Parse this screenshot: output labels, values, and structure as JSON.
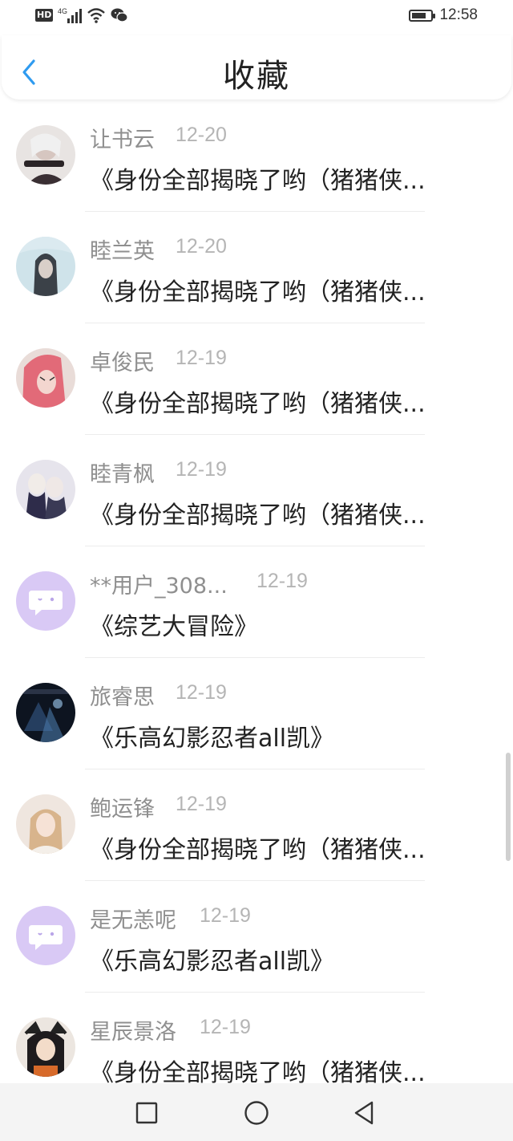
{
  "status_bar": {
    "hd": "HD",
    "network": "4G",
    "time": "12:58",
    "battery_level": 0.75
  },
  "header": {
    "title": "收藏",
    "back_icon": "chevron-left-icon"
  },
  "items": [
    {
      "name": "让书云",
      "date": "12-20",
      "message": "《身份全部揭晓了哟（猪猪侠...",
      "avatar": "anime-photo"
    },
    {
      "name": "睦兰英",
      "date": "12-20",
      "message": "《身份全部揭晓了哟（猪猪侠...",
      "avatar": "anime-photo"
    },
    {
      "name": "卓俊民",
      "date": "12-19",
      "message": "《身份全部揭晓了哟（猪猪侠...",
      "avatar": "anime-photo"
    },
    {
      "name": "睦青枫",
      "date": "12-19",
      "message": "《身份全部揭晓了哟（猪猪侠...",
      "avatar": "anime-photo"
    },
    {
      "name": "**用户_308...",
      "date": "12-19",
      "message": "《综艺大冒险》",
      "avatar": "chat-bubble-icon"
    },
    {
      "name": "旅睿思",
      "date": "12-19",
      "message": "《乐高幻影忍者all凯》",
      "avatar": "anime-photo"
    },
    {
      "name": "鲍运锋",
      "date": "12-19",
      "message": "《身份全部揭晓了哟（猪猪侠...",
      "avatar": "anime-photo"
    },
    {
      "name": "是无恙呢",
      "date": "12-19",
      "message": "《乐高幻影忍者all凯》",
      "avatar": "chat-bubble-icon"
    },
    {
      "name": "星辰景洛",
      "date": "12-19",
      "message": "《身份全部揭晓了哟（猪猪侠...",
      "avatar": "anime-photo"
    }
  ],
  "nav": {
    "recent_icon": "square-icon",
    "home_icon": "circle-icon",
    "back_icon": "triangle-back-icon"
  },
  "colors": {
    "accent": "#2f9bf0",
    "name_gray": "#8f8f8f",
    "date_gray": "#b5b5b5",
    "default_avatar_bg": "#d9c9f5"
  }
}
